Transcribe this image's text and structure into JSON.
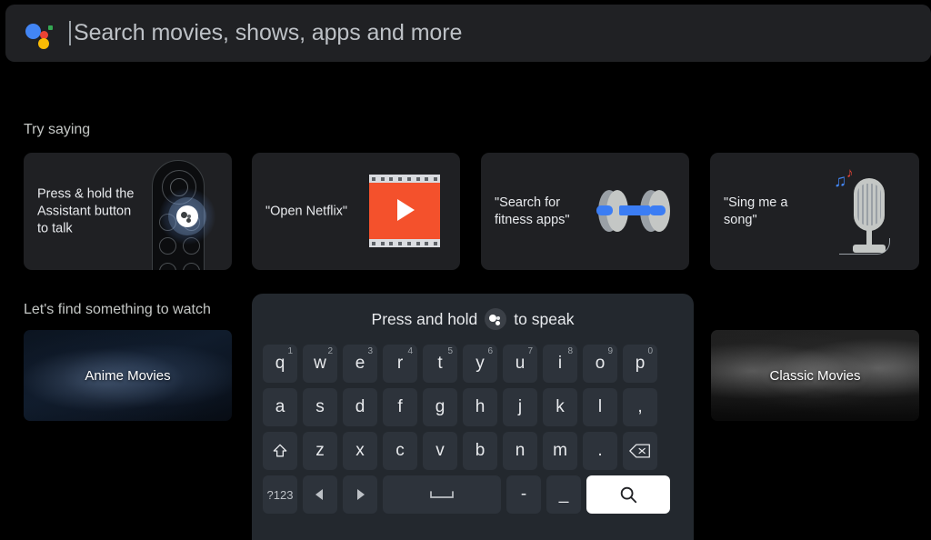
{
  "search": {
    "placeholder": "Search movies, shows, apps and more",
    "logo_icon": "google-assistant-icon",
    "caret_visible": true
  },
  "try_saying": {
    "title": "Try saying",
    "cards": [
      {
        "text": "Press & hold the Assistant button to talk",
        "art": "tv-remote-assistant-button-illustration"
      },
      {
        "text": "\"Open Netflix\"",
        "art": "film-strip-play-illustration"
      },
      {
        "text": "\"Search for fitness apps\"",
        "art": "dumbbell-illustration"
      },
      {
        "text": "\"Sing me a song\"",
        "art": "microphone-music-notes-illustration"
      }
    ]
  },
  "watch": {
    "title": "Let's find something to watch",
    "cards": [
      {
        "label": "Anime Movies"
      },
      {
        "label": "Classic Movies"
      }
    ]
  },
  "keyboard": {
    "header_prefix": "Press and hold",
    "header_suffix": "to speak",
    "header_icon": "assistant-mic-icon",
    "rows": [
      [
        {
          "label": "q",
          "alt": "1"
        },
        {
          "label": "w",
          "alt": "2"
        },
        {
          "label": "e",
          "alt": "3"
        },
        {
          "label": "r",
          "alt": "4"
        },
        {
          "label": "t",
          "alt": "5"
        },
        {
          "label": "y",
          "alt": "6"
        },
        {
          "label": "u",
          "alt": "7"
        },
        {
          "label": "i",
          "alt": "8"
        },
        {
          "label": "o",
          "alt": "9"
        },
        {
          "label": "p",
          "alt": "0"
        }
      ],
      [
        {
          "label": "a"
        },
        {
          "label": "s"
        },
        {
          "label": "d"
        },
        {
          "label": "f"
        },
        {
          "label": "g"
        },
        {
          "label": "h"
        },
        {
          "label": "j"
        },
        {
          "label": "k"
        },
        {
          "label": "l"
        },
        {
          "label": ","
        }
      ],
      [
        {
          "label": "",
          "icon": "shift-icon"
        },
        {
          "label": "z"
        },
        {
          "label": "x"
        },
        {
          "label": "c"
        },
        {
          "label": "v"
        },
        {
          "label": "b"
        },
        {
          "label": "n"
        },
        {
          "label": "m"
        },
        {
          "label": "."
        },
        {
          "label": "",
          "icon": "backspace-icon"
        }
      ],
      [
        {
          "label": "?123"
        },
        {
          "label": "",
          "icon": "arrow-left-icon"
        },
        {
          "label": "",
          "icon": "arrow-right-icon"
        },
        {
          "label": "",
          "icon": "space-icon"
        },
        {
          "label": "-"
        },
        {
          "label": "_"
        },
        {
          "label": "",
          "icon": "search-icon"
        }
      ]
    ]
  },
  "colors": {
    "background": "#000000",
    "searchbar": "#202124",
    "card": "#1f2023",
    "keyboard_panel": "#23282e",
    "key": "#2d333b",
    "search_key": "#ffffff",
    "accent_blue": "#4285F4",
    "accent_red": "#EA4335",
    "accent_yellow": "#FBBC05",
    "accent_green": "#34A853",
    "netflix_orange": "#F4512C",
    "dumbbell_blue": "#3B7DF4"
  }
}
